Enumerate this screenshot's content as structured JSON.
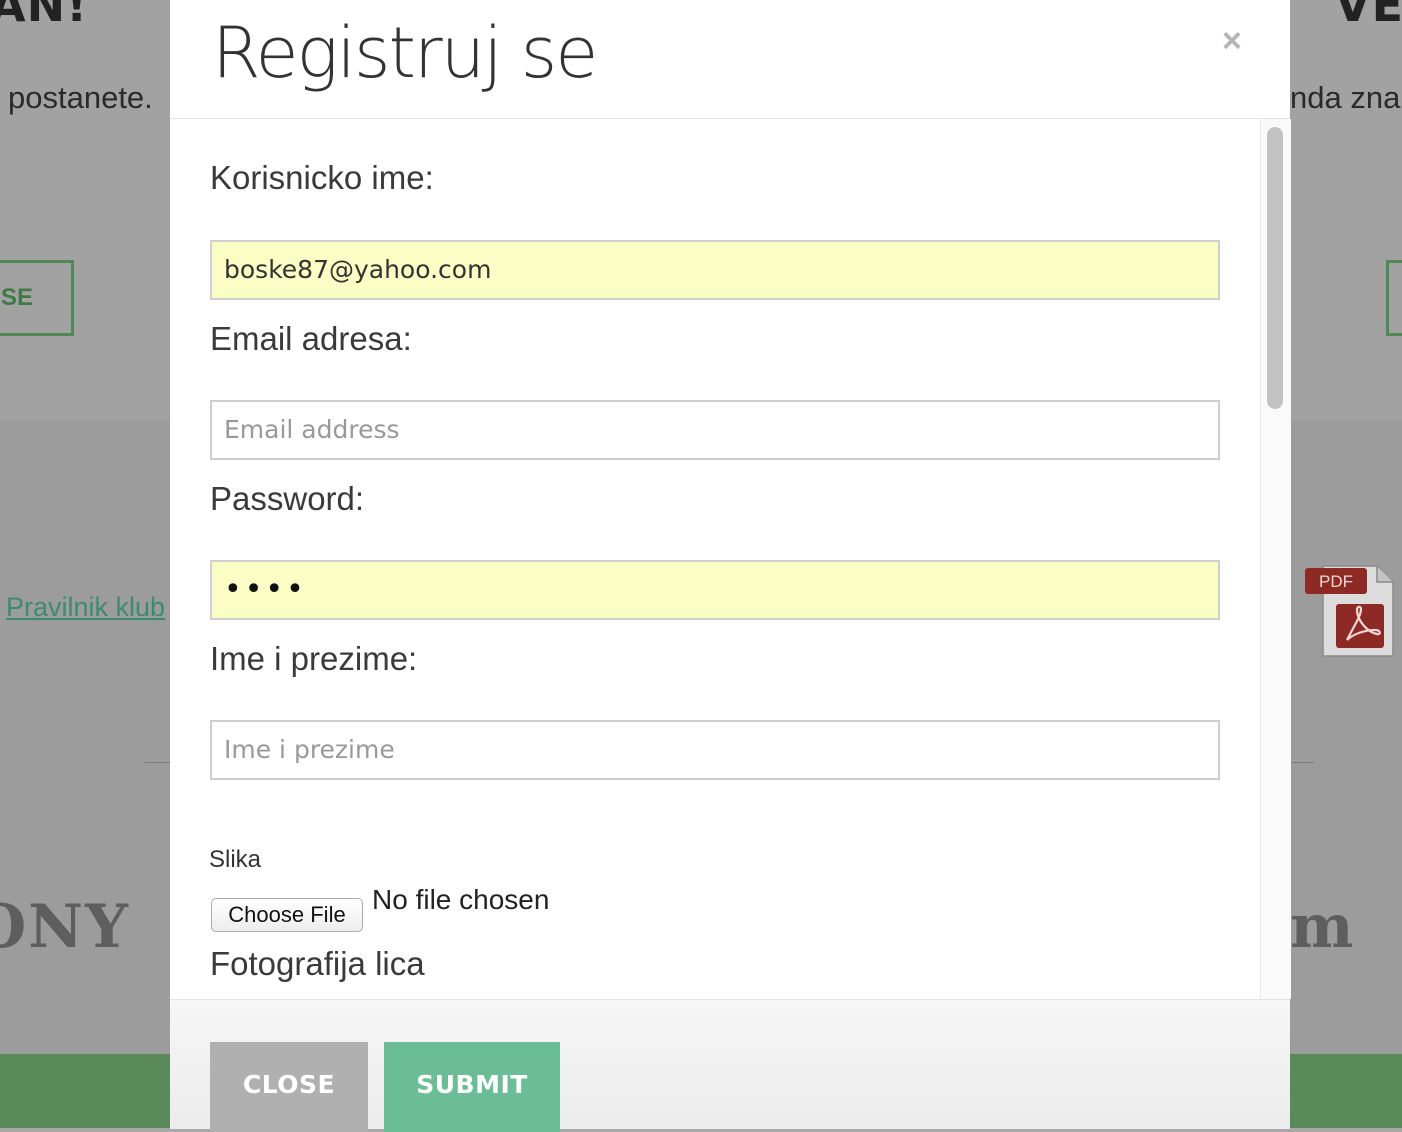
{
  "background": {
    "heading_left": "AN!",
    "heading_right": "VE",
    "text_left": "postanete.",
    "text_right": "nda zna",
    "button_left": "SE",
    "link": "Pravilnik klub",
    "pdf_label": "PDF",
    "logo_left": "ONY",
    "logo_right": "m"
  },
  "modal": {
    "title": "Registruj se",
    "close_symbol": "×",
    "fields": {
      "username": {
        "label": "Korisnicko ime:",
        "value": "boske87@yahoo.com"
      },
      "email": {
        "label": "Email adresa:",
        "placeholder": "Email address"
      },
      "password": {
        "label": "Password:",
        "value": "••••"
      },
      "fullname": {
        "label": "Ime i prezime:",
        "placeholder": "Ime i prezime"
      }
    },
    "file": {
      "label": "Slika",
      "button": "Choose File",
      "status": "No file chosen"
    },
    "next_label": "Fotografija lica",
    "footer": {
      "close": "CLOSE",
      "submit": "SUBMIT"
    }
  },
  "colors": {
    "autofill": "#fafec4",
    "submit": "#6bbd98",
    "close": "#b0b0b0",
    "bg_accent": "#4f8a55"
  }
}
